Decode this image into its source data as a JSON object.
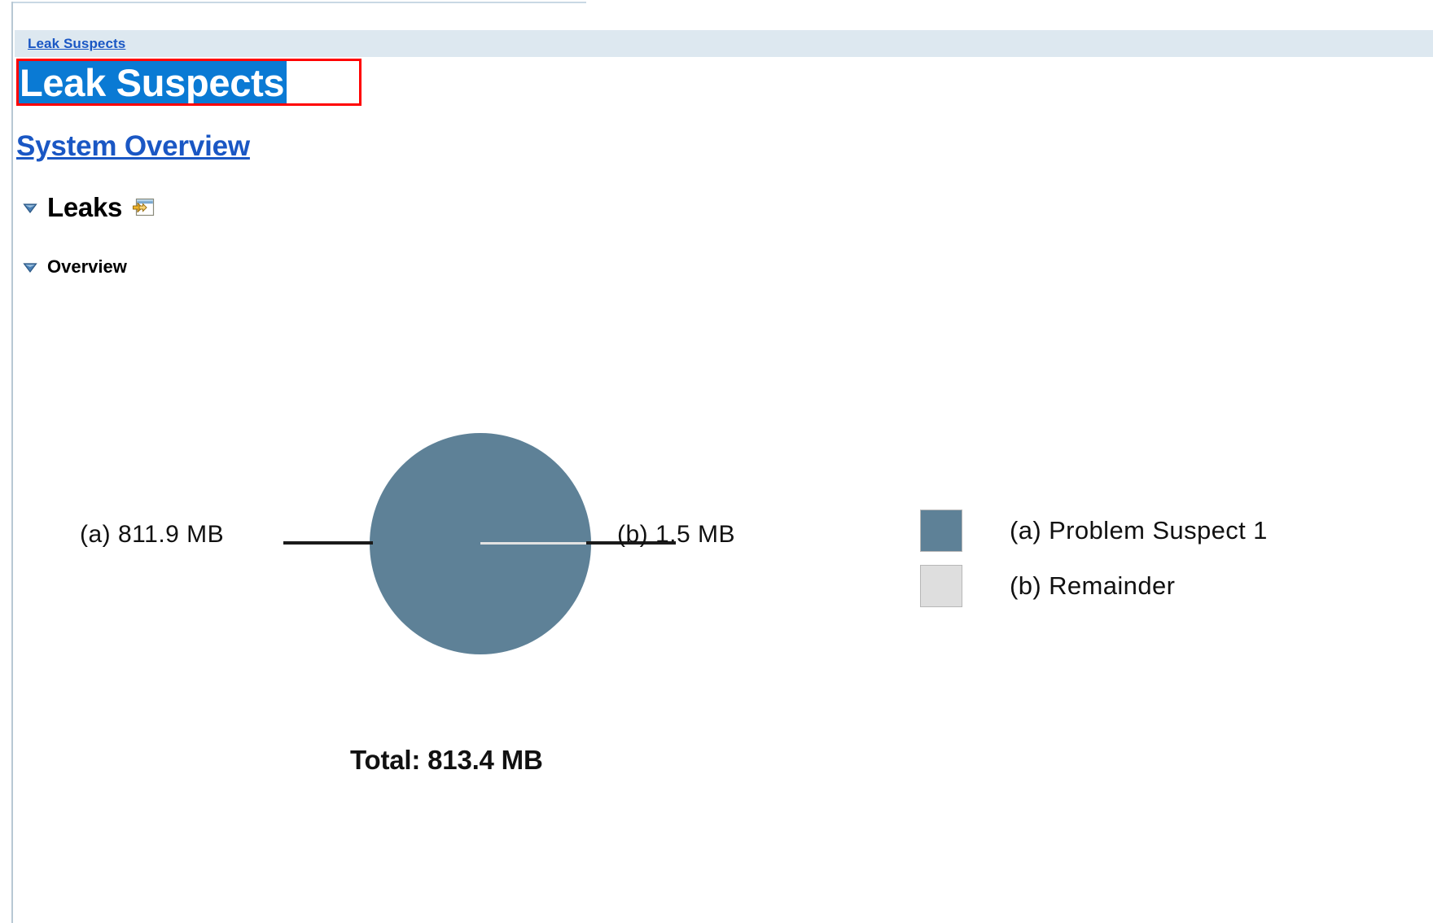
{
  "window": {
    "frame_border_color": "#c9d8e4"
  },
  "breadcrumb": {
    "items": [
      {
        "label": "Leak Suspects"
      }
    ]
  },
  "header": {
    "title": "Leak Suspects",
    "title_selected": true,
    "selection_highlight_color": "#0a7ad4",
    "annotation_box_color": "#ff0000"
  },
  "section": {
    "system_overview_link": "System Overview",
    "link_color": "#1a57c4"
  },
  "tree": {
    "nodes": [
      {
        "label": "Leaks",
        "expanded": true,
        "twisty_icon": "triangle-down-icon",
        "action_icon": "open-in-window-icon"
      },
      {
        "label": "Overview",
        "expanded": true,
        "twisty_icon": "triangle-down-icon"
      }
    ]
  },
  "chart_data": {
    "type": "pie",
    "title": "",
    "categories": [
      "(a) Problem Suspect 1",
      "(b) Remainder"
    ],
    "values": [
      811.9,
      1.5
    ],
    "value_labels": [
      "811.9 MB",
      "1.5 MB"
    ],
    "unit": "MB",
    "total": 813.4,
    "total_label": "Total: 813.4 MB",
    "callout_a": "(a)  811.9 MB",
    "callout_b": "(b)  1.5 MB",
    "colors": [
      "#5e8197",
      "#dedede"
    ],
    "legend_position": "right",
    "legend": [
      {
        "key": "(a)",
        "label": "(a)  Problem Suspect 1",
        "color": "#5e8197"
      },
      {
        "key": "(b)",
        "label": "(b)  Remainder",
        "color": "#dedede"
      }
    ],
    "grid": false
  }
}
